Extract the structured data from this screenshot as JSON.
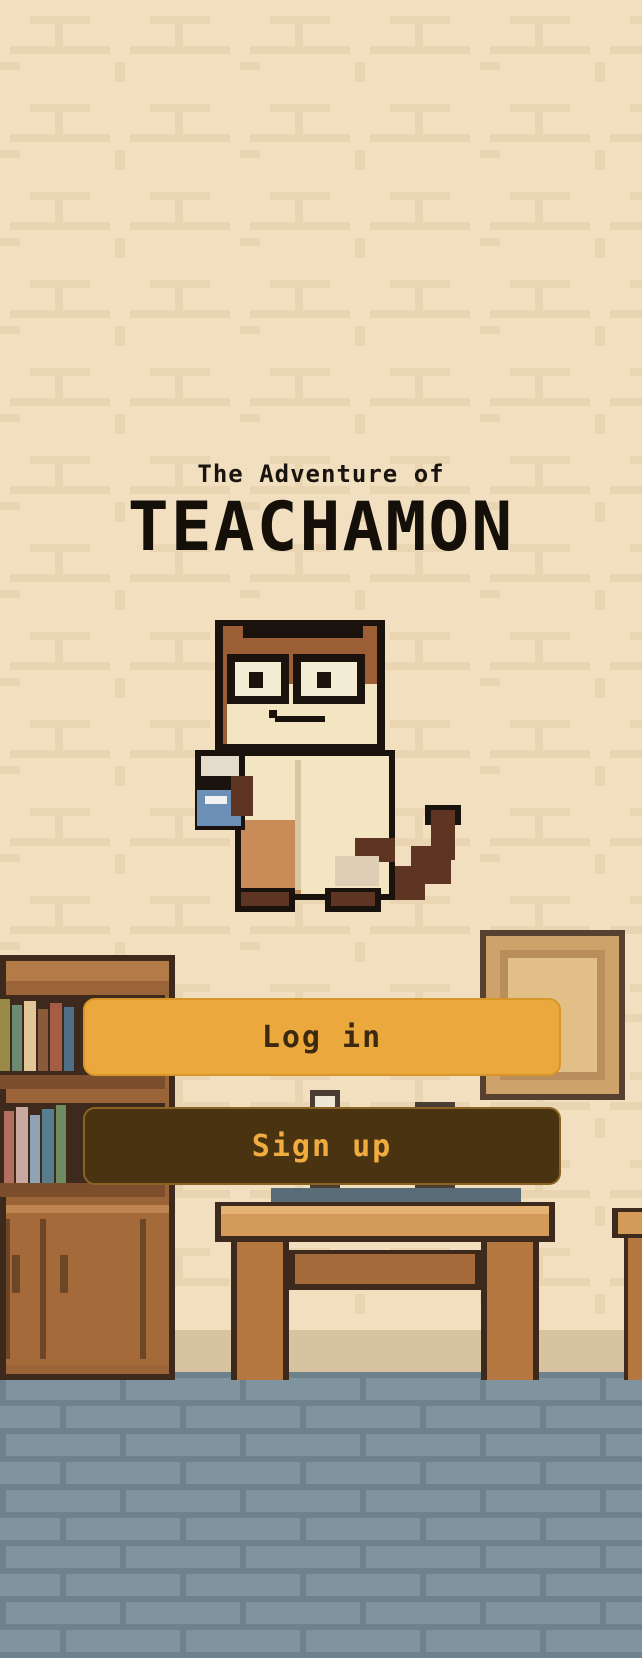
{
  "subtitle": "The Adventure of",
  "title": "TEACHAMON",
  "login_label": "Log in",
  "signup_label": "Sign up",
  "colors": {
    "wall": "#f1dfc0",
    "floor": "#7c919b",
    "login_button": "#eba93d",
    "signup_button": "#4a3310",
    "signup_text": "#f0ac3e",
    "title_text": "#150f0a"
  }
}
